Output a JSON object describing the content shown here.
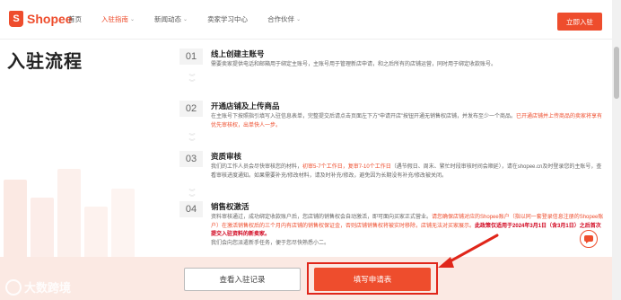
{
  "header": {
    "logo_text": "Shopee",
    "nav": [
      {
        "label": "首页",
        "dropdown": false,
        "active": false
      },
      {
        "label": "入驻指南",
        "dropdown": true,
        "active": true
      },
      {
        "label": "新闻动态",
        "dropdown": true,
        "active": false
      },
      {
        "label": "卖家学习中心",
        "dropdown": false,
        "active": false
      },
      {
        "label": "合作伙伴",
        "dropdown": true,
        "active": false
      }
    ],
    "join_label": "立即入驻"
  },
  "page_title": "入驻流程",
  "steps": [
    {
      "num": "01",
      "title": "线上创建主账号",
      "desc": "需要卖家提供电话和邮箱用于绑定主账号，主账号用于管理新店申请，和之后所有的店铺运营，同时用于绑定收款账号。"
    },
    {
      "num": "02",
      "title": "开通店铺及上传商品",
      "desc_a": "在主账号下按照指引填写入驻信息表单，完整提交后请点击页面左下方“申请开店”按钮开通无销售权店铺，并发布至少一个商品。",
      "desc_b": "已开通店铺并上传商品的卖家将享有优先审核权，出单快人一步。"
    },
    {
      "num": "03",
      "title": "资质审核",
      "desc_a": "我们的工作人员会尽快审核您的材料，",
      "desc_b": "初审5-7个工作日，复审7-10个工作日",
      "desc_c": "（遇节假日、周末、繁忙时段审核时间会顺延），请在shopee.cn及时登录您的主账号，查看审核进度通知。如果需要补充/修改材料，请及时补充/修改，避免因为长期没有补充/修改被关闭。"
    },
    {
      "num": "04",
      "title": "销售权激活",
      "desc_a": "资料审核通过，成功绑定收款账户后，您店铺的销售权会自动激活，即可面向买家正式营业。",
      "desc_b": "请您确保店铺对应的Shopee账户（指以同一套登录信息注册的Shopee账户）在激活销售权后的三个月内有店铺的销售权保证金，否则店铺销售权将被实时移除，店铺无法对买家展示。",
      "desc_c": "此政策仅适用于2024年3月1日（含3月1日）之后首次提交入驻资料的新卖家。",
      "desc_d": "我们会向您派遣新手任务，便于您尽快熟悉小二。"
    }
  ],
  "bottom": {
    "record_label": "查看入驻记录",
    "apply_label": "填写申请表"
  },
  "watermark": "大数跨境",
  "colors": {
    "brand": "#ee4d2d",
    "annotation": "#e0261a",
    "bottom_bg": "#fbe9e3"
  }
}
